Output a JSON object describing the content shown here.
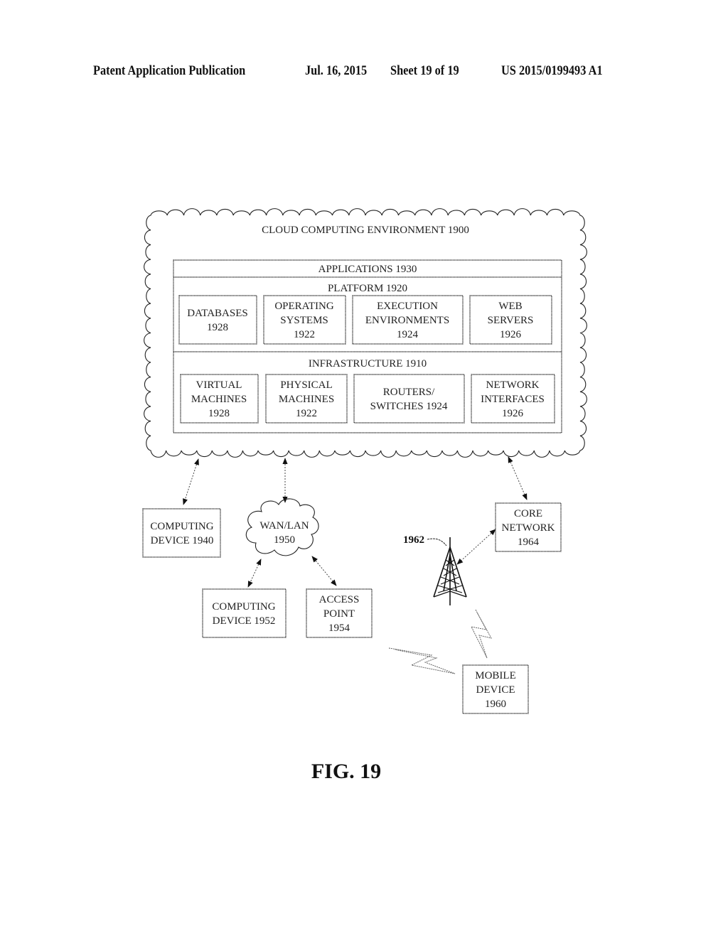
{
  "header": {
    "publication": "Patent Application Publication",
    "date": "Jul. 16, 2015",
    "sheet": "Sheet 19 of 19",
    "number": "US 2015/0199493 A1"
  },
  "diagram": {
    "cloud_title": "CLOUD COMPUTING ENVIRONMENT 1900",
    "applications": "APPLICATIONS 1930",
    "platform": {
      "title": "PLATFORM 1920",
      "items": [
        {
          "lines": [
            "DATABASES",
            "1928"
          ]
        },
        {
          "lines": [
            "OPERATING",
            "SYSTEMS",
            "1922"
          ]
        },
        {
          "lines": [
            "EXECUTION",
            "ENVIRONMENTS",
            "1924"
          ]
        },
        {
          "lines": [
            "WEB",
            "SERVERS",
            "1926"
          ]
        }
      ]
    },
    "infrastructure": {
      "title": "INFRASTRUCTURE 1910",
      "items": [
        {
          "lines": [
            "VIRTUAL",
            "MACHINES",
            "1928"
          ]
        },
        {
          "lines": [
            "PHYSICAL",
            "MACHINES",
            "1922"
          ]
        },
        {
          "lines": [
            "ROUTERS/",
            "SWITCHES 1924"
          ]
        },
        {
          "lines": [
            "NETWORK",
            "INTERFACES",
            "1926"
          ]
        }
      ]
    },
    "computing_device_1940": {
      "lines": [
        "COMPUTING",
        "DEVICE 1940"
      ]
    },
    "wan_lan": {
      "lines": [
        "WAN/LAN",
        "1950"
      ]
    },
    "computing_device_1952": {
      "lines": [
        "COMPUTING",
        "DEVICE 1952"
      ]
    },
    "access_point": {
      "lines": [
        "ACCESS",
        "POINT",
        "1954"
      ]
    },
    "core_network": {
      "lines": [
        "CORE",
        "NETWORK",
        "1964"
      ]
    },
    "tower_label": "1962",
    "mobile_device": {
      "lines": [
        "MOBILE",
        "DEVICE",
        "1960"
      ]
    },
    "figure_label": "FIG. 19"
  }
}
